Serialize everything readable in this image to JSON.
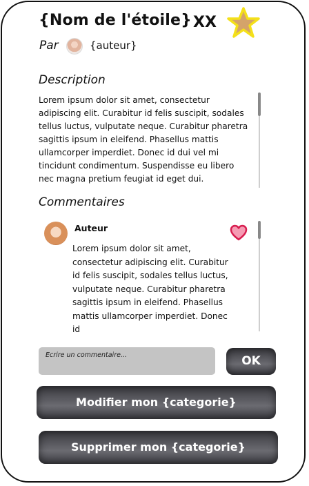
{
  "header": {
    "title": "{Nom de l'étoile}",
    "rating": "XX",
    "by_label": "Par",
    "author": "{auteur}"
  },
  "description": {
    "title": "Description",
    "text": "Lorem ipsum dolor sit amet, consectetur adipiscing elit. Curabitur id felis suscipit, sodales tellus luctus, vulputate neque. Curabitur pharetra sagittis ipsum in eleifend. Phasellus mattis ullamcorper imperdiet. Donec id dui vel mi tincidunt condimentum. Suspendisse eu libero nec magna pretium feugiat id eget dui."
  },
  "comments": {
    "title": "Commentaires",
    "items": [
      {
        "author": "Auteur",
        "text": "Lorem ipsum dolor sit amet, consectetur adipiscing elit. Curabitur id felis suscipit, sodales tellus luctus, vulputate neque. Curabitur pharetra sagittis ipsum in eleifend. Phasellus mattis ullamcorper imperdiet. Donec id"
      }
    ]
  },
  "comment_form": {
    "placeholder": "Ecrire un commentaire...",
    "submit_label": "OK"
  },
  "actions": {
    "modify_label": "Modifier mon {categorie}",
    "delete_label": "Supprimer mon {categorie}"
  },
  "icons": {
    "star": "star-icon",
    "heart": "heart-icon"
  },
  "colors": {
    "star_fill": "#d4a36a",
    "star_stroke": "#f4e01a",
    "heart_fill": "#f59bb3",
    "heart_stroke": "#d81d4f",
    "button_dark": "#4a4a50",
    "input_bg": "#c4c4c4"
  }
}
